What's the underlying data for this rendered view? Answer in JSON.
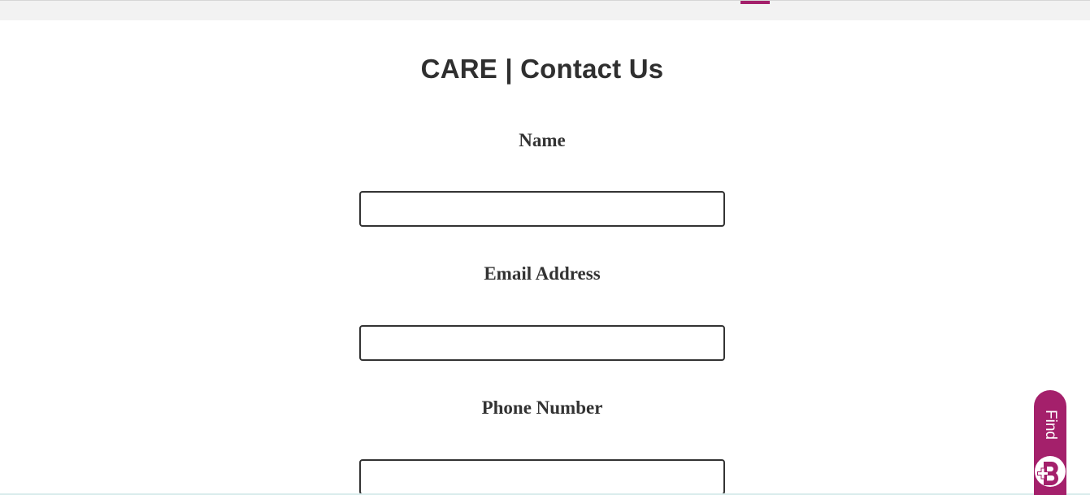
{
  "page": {
    "title": "CARE | Contact Us"
  },
  "form": {
    "fields": [
      {
        "label": "Name",
        "value": "",
        "placeholder": ""
      },
      {
        "label": "Email Address",
        "value": "",
        "placeholder": ""
      },
      {
        "label": "Phone Number",
        "value": "",
        "placeholder": ""
      }
    ]
  },
  "find_widget": {
    "label": "Find",
    "icon": "plus-b-logo-icon"
  },
  "colors": {
    "accent": "#a4206b",
    "text": "#333333",
    "top_bar": "#f2f2f2",
    "background": "#ffffff"
  }
}
